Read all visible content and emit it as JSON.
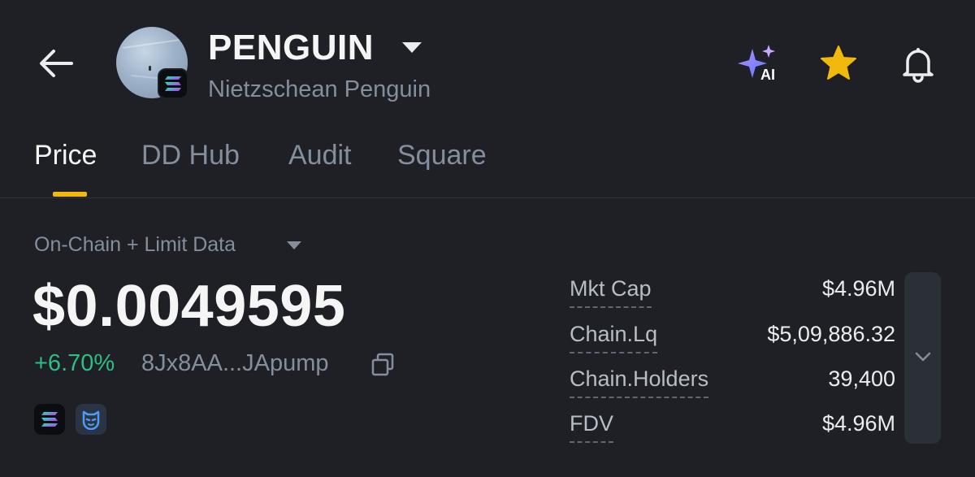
{
  "header": {
    "symbol": "PENGUIN",
    "name": "Nietzschean Penguin",
    "ai_badge": "AI",
    "icons": [
      "back-arrow-icon",
      "caret-down-icon",
      "ai-sparkle-icon",
      "star-icon",
      "bell-icon"
    ]
  },
  "tabs": [
    {
      "label": "Price",
      "active": true
    },
    {
      "label": "DD Hub",
      "active": false
    },
    {
      "label": "Audit",
      "active": false
    },
    {
      "label": "Square",
      "active": false
    }
  ],
  "price_section": {
    "data_source": "On-Chain + Limit Data",
    "price": "$0.0049595",
    "change": "+6.70%",
    "contract": "8Jx8AA...JApump",
    "chain_badges": [
      "solana-icon",
      "mask-icon"
    ]
  },
  "stats": [
    {
      "label": "Mkt Cap",
      "value": "$4.96M"
    },
    {
      "label": "Chain.Lq",
      "value": "$5,09,886.32"
    },
    {
      "label": "Chain.Holders",
      "value": "39,400"
    },
    {
      "label": "FDV",
      "value": "$4.96M"
    }
  ],
  "colors": {
    "background": "#1e2026",
    "accent": "#f0b90b",
    "positive": "#2ebd85",
    "muted": "#848e9c"
  }
}
